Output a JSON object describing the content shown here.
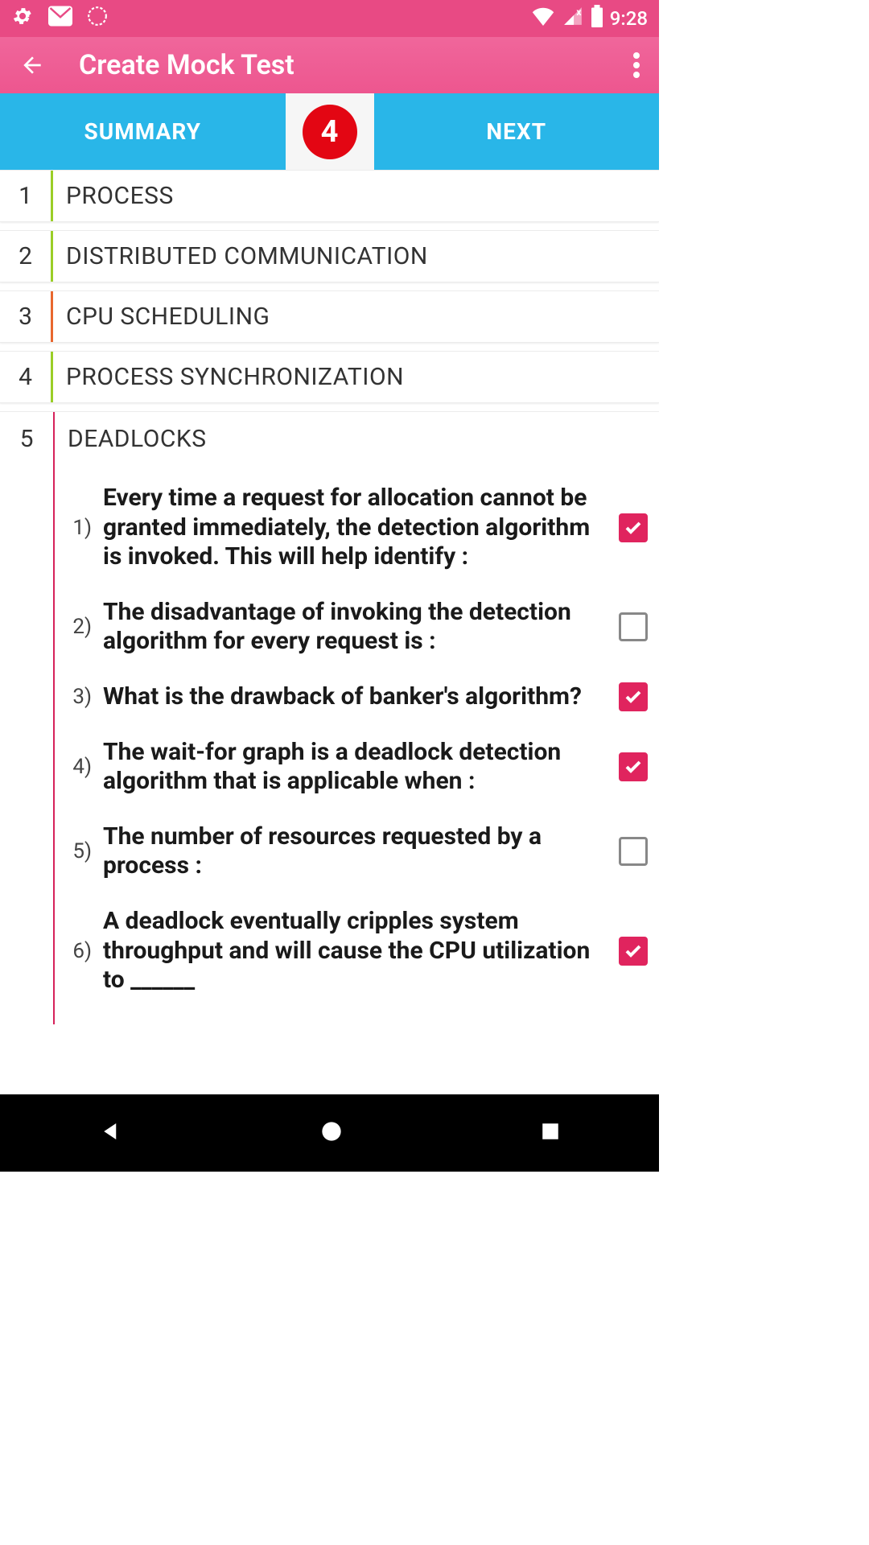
{
  "status": {
    "time": "9:28"
  },
  "header": {
    "title": "Create Mock Test"
  },
  "tabs": {
    "summary": "SUMMARY",
    "badge": "4",
    "next": "NEXT"
  },
  "sections": [
    {
      "num": "1",
      "title": "PROCESS"
    },
    {
      "num": "2",
      "title": "DISTRIBUTED COMMUNICATION"
    },
    {
      "num": "3",
      "title": "CPU SCHEDULING"
    },
    {
      "num": "4",
      "title": "PROCESS SYNCHRONIZATION"
    }
  ],
  "expanded": {
    "num": "5",
    "title": "DEADLOCKS",
    "questions": [
      {
        "num": "1)",
        "text": "Every time a request for allocation cannot be granted immediately, the detection algorithm is invoked. This will help identify :",
        "checked": true
      },
      {
        "num": "2)",
        "text": "The disadvantage of invoking the detection algorithm for every request is :",
        "checked": false
      },
      {
        "num": "3)",
        "text": "What is the drawback of banker's algorithm?",
        "checked": true
      },
      {
        "num": "4)",
        "text": "The wait-for graph is a deadlock detection algorithm that is applicable when :",
        "checked": true
      },
      {
        "num": "5)",
        "text": "The number of resources requested by a process :",
        "checked": false
      },
      {
        "num": "6)",
        "text": "A deadlock eventually cripples system throughput and will cause the CPU utilization to ______",
        "checked": true
      }
    ]
  }
}
